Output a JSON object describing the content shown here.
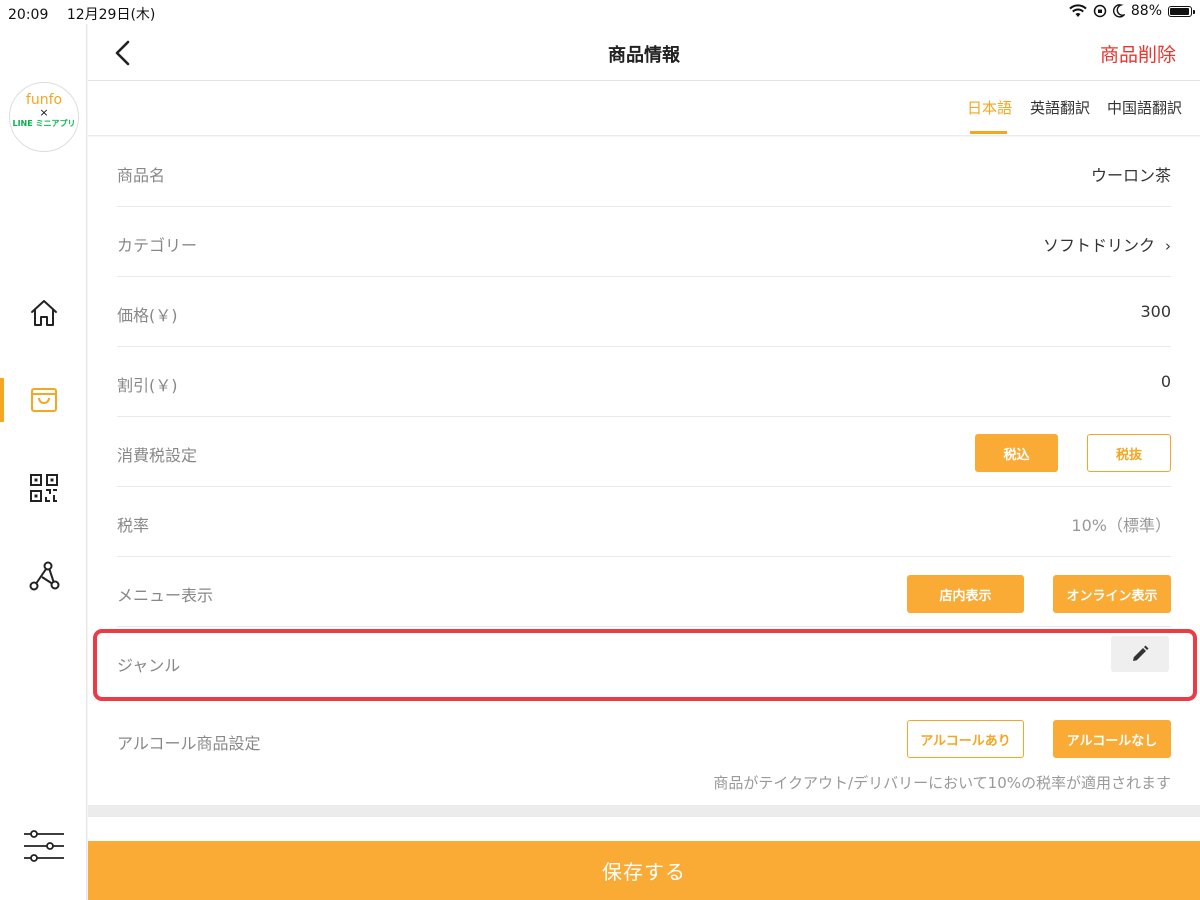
{
  "status_bar": {
    "time": "20:09",
    "date": "12月29日(木)",
    "battery": "88%",
    "battery_level": 0.88
  },
  "sidebar": {
    "logo": {
      "line1": "funfo",
      "line2": "×",
      "line3": "LINE ミニアプリ"
    },
    "items": [
      {
        "icon": "home-icon",
        "active": false
      },
      {
        "icon": "shopping-bag-icon",
        "active": true
      },
      {
        "icon": "qr-code-icon",
        "active": false
      },
      {
        "icon": "share-network-icon",
        "active": false
      }
    ],
    "bottom_icon": "settings-sliders-icon"
  },
  "header": {
    "title": "商品情報",
    "delete_label": "商品削除"
  },
  "language_tabs": [
    {
      "label": "日本語",
      "active": true
    },
    {
      "label": "英語翻訳",
      "active": false
    },
    {
      "label": "中国語翻訳",
      "active": false
    }
  ],
  "form": {
    "name": {
      "label": "商品名",
      "value": "ウーロン茶"
    },
    "category": {
      "label": "カテゴリー",
      "value": "ソフトドリンク"
    },
    "price": {
      "label": "価格(￥)",
      "value": "300"
    },
    "discount": {
      "label": "割引(￥)",
      "value": "0"
    },
    "tax_setting": {
      "label": "消費税設定",
      "options": [
        {
          "label": "税込",
          "selected": true
        },
        {
          "label": "税抜",
          "selected": false
        }
      ]
    },
    "tax_rate": {
      "label": "税率",
      "value": "10%（標準）"
    },
    "menu_display": {
      "label": "メニュー表示",
      "options": [
        {
          "label": "店内表示",
          "selected": true
        },
        {
          "label": "オンライン表示",
          "selected": true
        }
      ]
    },
    "genre": {
      "label": "ジャンル",
      "edit_icon": "pencil-icon"
    },
    "alcohol": {
      "label": "アルコール商品設定",
      "options": [
        {
          "label": "アルコールあり",
          "selected": false
        },
        {
          "label": "アルコールなし",
          "selected": true
        }
      ],
      "note": "商品がテイクアウト/デリバリーにおいて10%の税率が適用されます"
    }
  },
  "save_label": "保存する",
  "colors": {
    "accent": "#f5a623",
    "button_fill": "#f9ab35",
    "danger": "#e8352e",
    "highlight": "#ec3b45"
  }
}
